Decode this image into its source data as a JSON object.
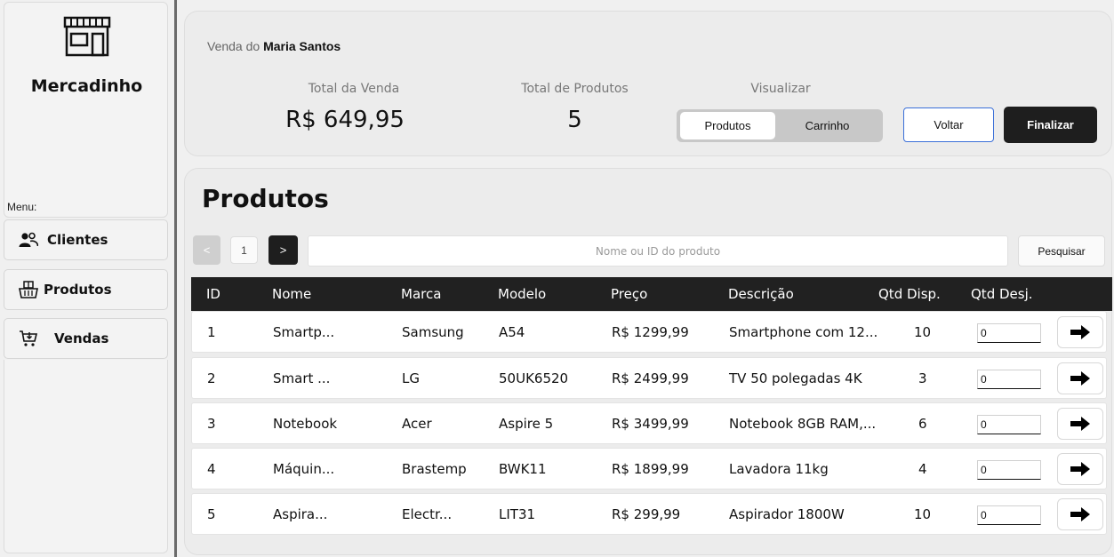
{
  "sidebar": {
    "app_name": "Mercadinho",
    "menu_label": "Menu:",
    "items": [
      {
        "label": "Clientes",
        "icon": "users-icon"
      },
      {
        "label": "Produtos",
        "icon": "basket-icon"
      },
      {
        "label": "Vendas",
        "icon": "cart-icon"
      }
    ]
  },
  "header": {
    "sale_prefix": "Venda do",
    "client_name": "Maria Santos",
    "total_sale_label": "Total da Venda",
    "total_sale_value": "R$ 649,95",
    "total_products_label": "Total de Produtos",
    "total_products_value": "5",
    "view_label": "Visualizar",
    "view_options": [
      "Produtos",
      "Carrinho"
    ],
    "view_selected": "Produtos",
    "back_label": "Voltar",
    "finish_label": "Finalizar"
  },
  "products": {
    "title": "Produtos",
    "pagination": {
      "prev": "<",
      "page": "1",
      "next": ">"
    },
    "search_placeholder": "Nome ou ID do produto",
    "search_button": "Pesquisar",
    "columns": [
      "ID",
      "Nome",
      "Marca",
      "Modelo",
      "Preço",
      "Descrição",
      "Qtd Disp.",
      "Qtd Desj."
    ],
    "rows": [
      {
        "id": "1",
        "nome": "Smartp...",
        "marca": "Samsung",
        "modelo": "A54",
        "preco": "R$ 1299,99",
        "descricao": "Smartphone com 12...",
        "qtd_disp": "10",
        "qtd_desj": "0"
      },
      {
        "id": "2",
        "nome": "Smart ...",
        "marca": "LG",
        "modelo": "50UK6520",
        "preco": "R$ 2499,99",
        "descricao": "TV 50 polegadas 4K",
        "qtd_disp": "3",
        "qtd_desj": "0"
      },
      {
        "id": "3",
        "nome": "Notebook",
        "marca": "Acer",
        "modelo": "Aspire 5",
        "preco": "R$ 3499,99",
        "descricao": "Notebook 8GB RAM,...",
        "qtd_disp": "6",
        "qtd_desj": "0"
      },
      {
        "id": "4",
        "nome": "Máquin...",
        "marca": "Brastemp",
        "modelo": "BWK11",
        "preco": "R$ 1899,99",
        "descricao": "Lavadora 11kg",
        "qtd_disp": "4",
        "qtd_desj": "0"
      },
      {
        "id": "5",
        "nome": "Aspira...",
        "marca": "Electr...",
        "modelo": "LIT31",
        "preco": "R$ 299,99",
        "descricao": "Aspirador 1800W",
        "qtd_disp": "10",
        "qtd_desj": "0"
      }
    ],
    "row_action_icon": "arrow-right-icon"
  },
  "colors": {
    "dark": "#1e1e1e",
    "accent_border": "#3a6fd8",
    "card_bg": "#ececec"
  }
}
